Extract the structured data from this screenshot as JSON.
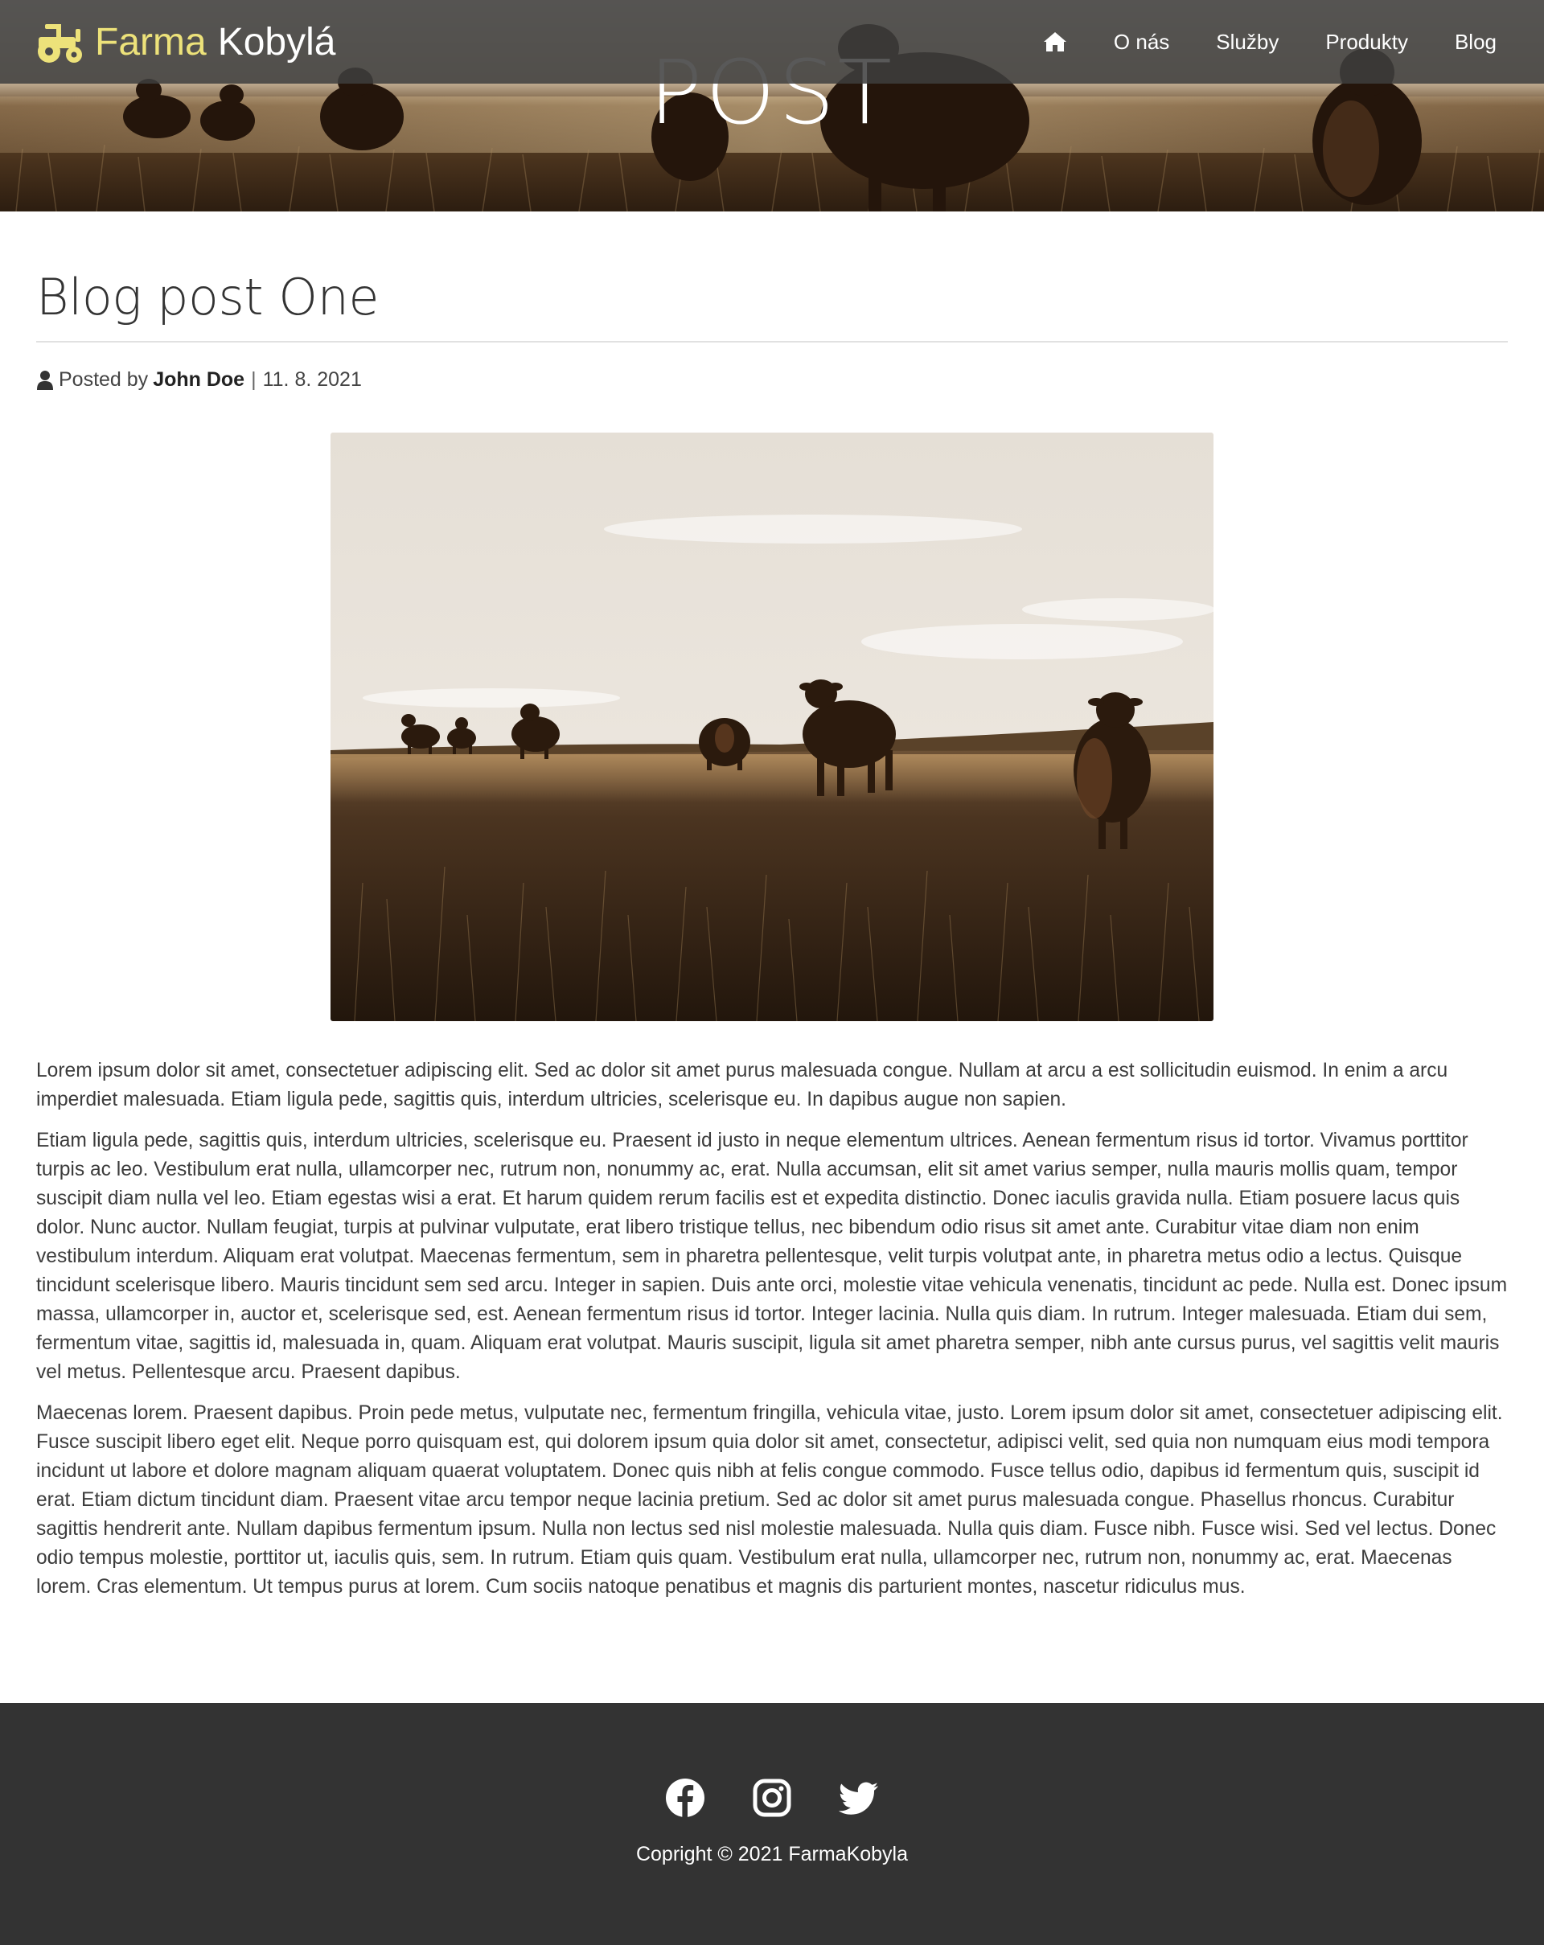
{
  "brand": {
    "word1": "Farma",
    "word2": "Kobylá",
    "icon": "tractor-icon",
    "accent_color": "#ede27a"
  },
  "nav": {
    "home_icon": "home-icon",
    "items": [
      {
        "label": "O nás"
      },
      {
        "label": "Služby"
      },
      {
        "label": "Produkty"
      },
      {
        "label": "Blog"
      }
    ]
  },
  "hero": {
    "title": "POST"
  },
  "post": {
    "title": "Blog post One",
    "posted_by": "Posted by",
    "author": "John Doe",
    "separator": "|",
    "date": "11. 8. 2021",
    "paragraphs": [
      "Lorem ipsum dolor sit amet, consectetuer adipiscing elit. Sed ac dolor sit amet purus malesuada congue. Nullam at arcu a est sollicitudin euismod. In enim a arcu imperdiet malesuada. Etiam ligula pede, sagittis quis, interdum ultricies, scelerisque eu. In dapibus augue non sapien.",
      "Etiam ligula pede, sagittis quis, interdum ultricies, scelerisque eu. Praesent id justo in neque elementum ultrices. Aenean fermentum risus id tortor. Vivamus porttitor turpis ac leo. Vestibulum erat nulla, ullamcorper nec, rutrum non, nonummy ac, erat. Nulla accumsan, elit sit amet varius semper, nulla mauris mollis quam, tempor suscipit diam nulla vel leo. Etiam egestas wisi a erat. Et harum quidem rerum facilis est et expedita distinctio. Donec iaculis gravida nulla. Etiam posuere lacus quis dolor. Nunc auctor. Nullam feugiat, turpis at pulvinar vulputate, erat libero tristique tellus, nec bibendum odio risus sit amet ante. Curabitur vitae diam non enim vestibulum interdum. Aliquam erat volutpat. Maecenas fermentum, sem in pharetra pellentesque, velit turpis volutpat ante, in pharetra metus odio a lectus. Quisque tincidunt scelerisque libero. Mauris tincidunt sem sed arcu. Integer in sapien. Duis ante orci, molestie vitae vehicula venenatis, tincidunt ac pede. Nulla est. Donec ipsum massa, ullamcorper in, auctor et, scelerisque sed, est. Aenean fermentum risus id tortor. Integer lacinia. Nulla quis diam. In rutrum. Integer malesuada. Etiam dui sem, fermentum vitae, sagittis id, malesuada in, quam. Aliquam erat volutpat. Mauris suscipit, ligula sit amet pharetra semper, nibh ante cursus purus, vel sagittis velit mauris vel metus. Pellentesque arcu. Praesent dapibus.",
      "Maecenas lorem. Praesent dapibus. Proin pede metus, vulputate nec, fermentum fringilla, vehicula vitae, justo. Lorem ipsum dolor sit amet, consectetuer adipiscing elit. Fusce suscipit libero eget elit. Neque porro quisquam est, qui dolorem ipsum quia dolor sit amet, consectetur, adipisci velit, sed quia non numquam eius modi tempora incidunt ut labore et dolore magnam aliquam quaerat voluptatem. Donec quis nibh at felis congue commodo. Fusce tellus odio, dapibus id fermentum quis, suscipit id erat. Etiam dictum tincidunt diam. Praesent vitae arcu tempor neque lacinia pretium. Sed ac dolor sit amet purus malesuada congue. Phasellus rhoncus. Curabitur sagittis hendrerit ante. Nullam dapibus fermentum ipsum. Nulla non lectus sed nisl molestie malesuada. Nulla quis diam. Fusce nibh. Fusce wisi. Sed vel lectus. Donec odio tempus molestie, porttitor ut, iaculis quis, sem. In rutrum. Etiam quis quam. Vestibulum erat nulla, ullamcorper nec, rutrum non, nonummy ac, erat. Maecenas lorem. Cras elementum. Ut tempus purus at lorem. Cum sociis natoque penatibus et magnis dis parturient montes, nascetur ridiculus mus."
    ]
  },
  "footer": {
    "social": [
      "facebook-icon",
      "instagram-icon",
      "twitter-icon"
    ],
    "copyright": "Copright © 2021 FarmaKobyla",
    "background": "#333333"
  }
}
